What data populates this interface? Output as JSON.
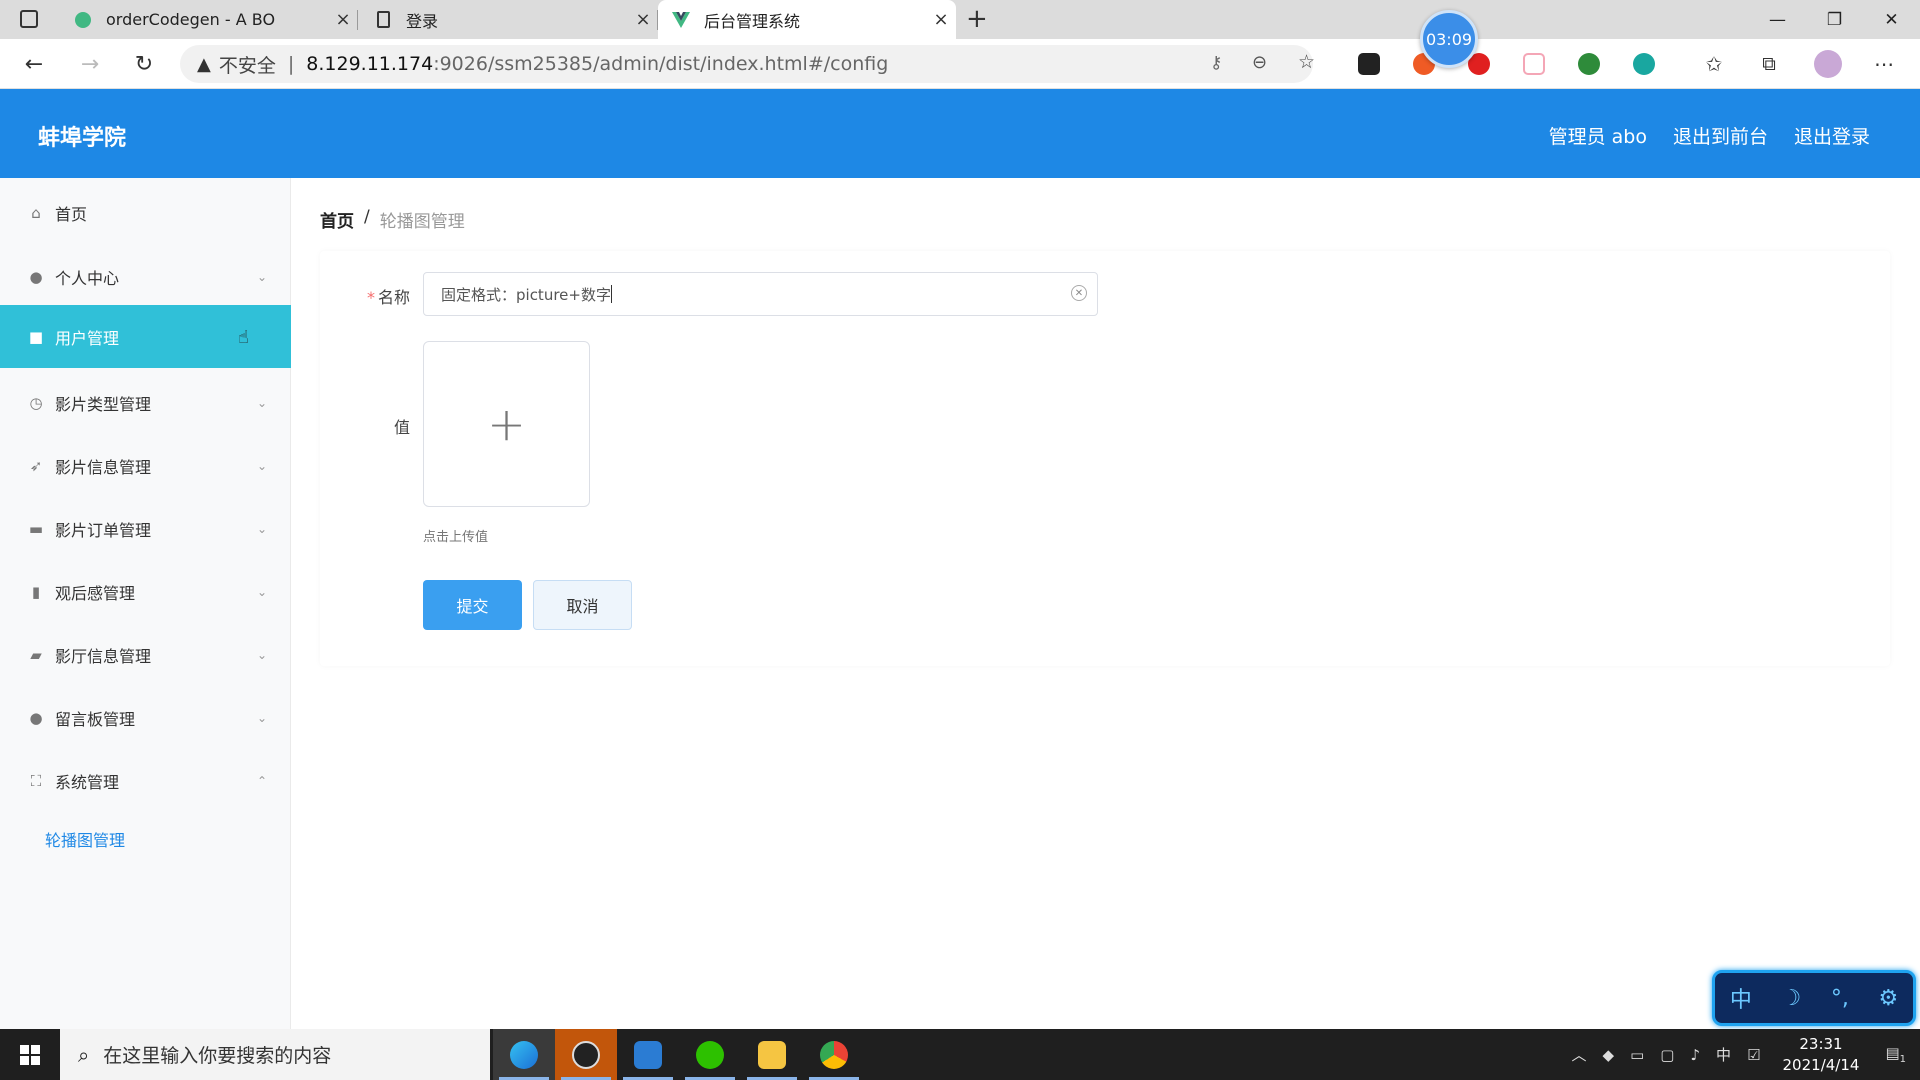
{
  "browser": {
    "tabs": [
      {
        "title": "orderCodegen - A BO",
        "close": "×"
      },
      {
        "title": "登录",
        "close": "×"
      },
      {
        "title": "后台管理系统",
        "close": "×"
      }
    ],
    "new_tab": "+",
    "url_warning": "不安全",
    "url_sep": "|",
    "url_host": "8.129.11.174",
    "url_path": ":9026/ssm25385/admin/dist/index.html#/config",
    "timer": "03:09"
  },
  "app": {
    "brand": "蚌埠学院",
    "header_links": [
      "管理员 abo",
      "退出到前台",
      "退出登录"
    ],
    "sidebar": [
      {
        "label": "首页",
        "icon": "home-icon"
      },
      {
        "label": "个人中心",
        "icon": "user-icon"
      },
      {
        "label": "用户管理",
        "icon": "users-icon"
      },
      {
        "label": "影片类型管理",
        "icon": "clock-icon"
      },
      {
        "label": "影片信息管理",
        "icon": "send-icon"
      },
      {
        "label": "影片订单管理",
        "icon": "briefcase-icon"
      },
      {
        "label": "观后感管理",
        "icon": "bar-chart-icon"
      },
      {
        "label": "影厅信息管理",
        "icon": "message-icon"
      },
      {
        "label": "留言板管理",
        "icon": "bulb-icon"
      },
      {
        "label": "系统管理",
        "icon": "scan-icon"
      }
    ],
    "sidebar_sub": "轮播图管理",
    "breadcrumb": {
      "home": "首页",
      "sep": "/",
      "current": "轮播图管理"
    },
    "form": {
      "name_label": "名称",
      "name_value": "固定格式：picture+数字",
      "value_label": "值",
      "upload_tip": "点击上传值",
      "submit": "提交",
      "cancel": "取消"
    }
  },
  "ime_widget": [
    "中",
    "☽",
    "°,",
    "⚙"
  ],
  "taskbar": {
    "search_placeholder": "在这里输入你要搜索的内容",
    "ime": "中",
    "time": "23:31",
    "date": "2021/4/14",
    "notify_count": "1"
  }
}
